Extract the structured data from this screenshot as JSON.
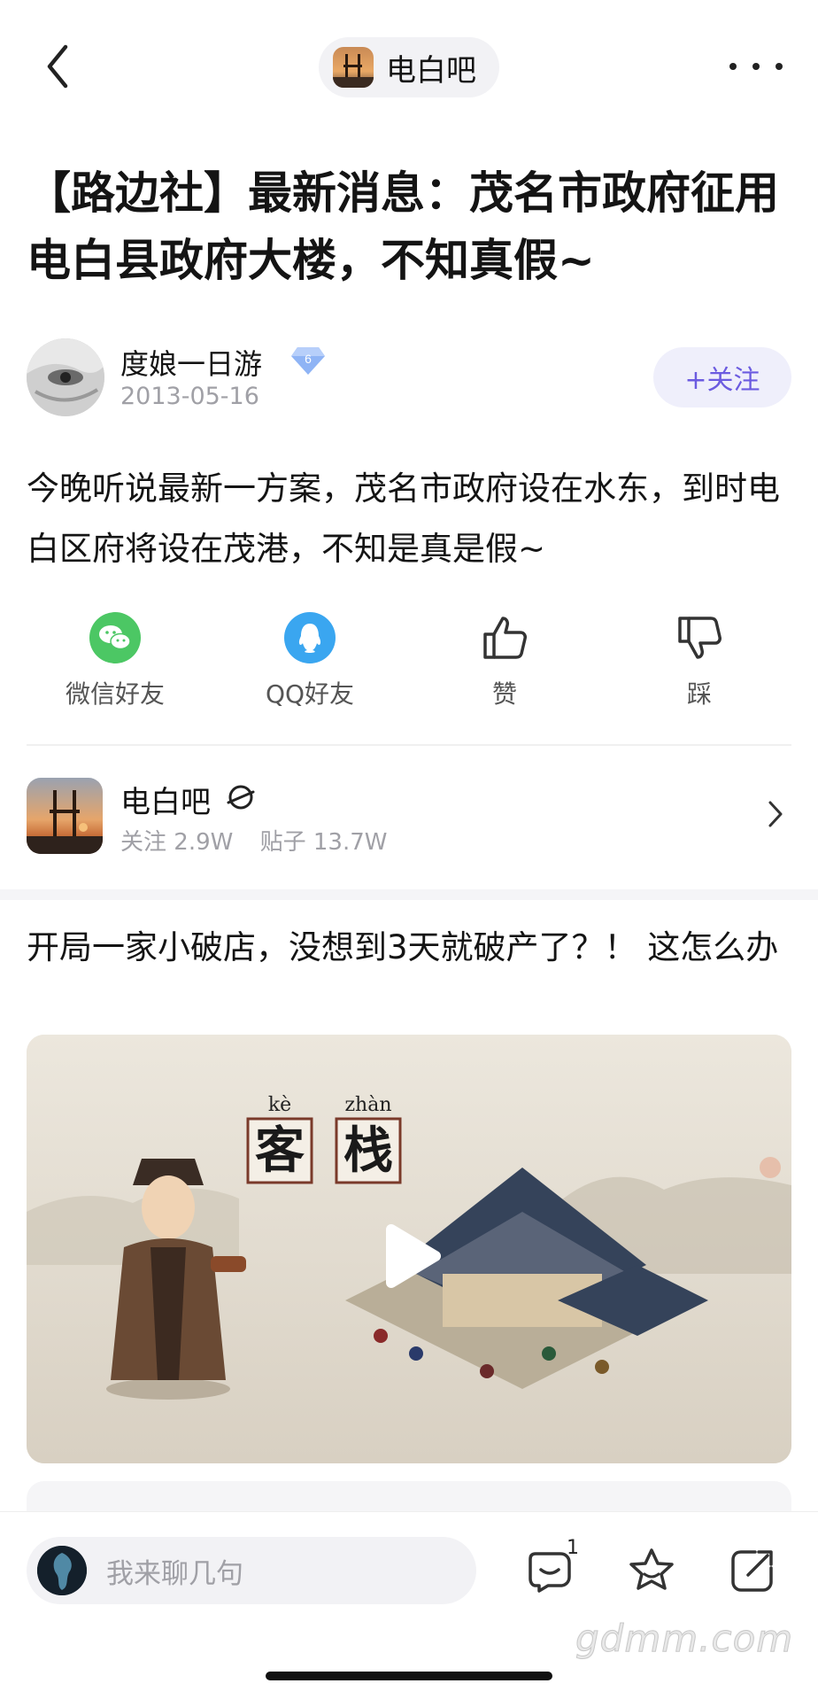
{
  "header": {
    "forum_name": "电白吧"
  },
  "post": {
    "title": "【路边社】最新消息：茂名市政府征用电白县政府大楼，不知真假~",
    "author": "度娘一日游",
    "level": "6",
    "date": "2013-05-16",
    "follow_label": "+关注",
    "body": "今晚听说最新一方案，茂名市政府设在水东，到时电白区府将设在茂港，不知是真是假~"
  },
  "share": {
    "items": [
      {
        "label": "微信好友",
        "icon": "wechat-icon"
      },
      {
        "label": "QQ好友",
        "icon": "qq-icon"
      },
      {
        "label": "赞",
        "icon": "thumbs-up-icon"
      },
      {
        "label": "踩",
        "icon": "thumbs-down-icon"
      }
    ]
  },
  "forum_card": {
    "name": "电白吧",
    "follow_label": "关注",
    "follow_count": "2.9W",
    "post_label": "贴子",
    "post_count": "13.7W"
  },
  "recommended": {
    "title": "开局一家小破店，没想到3天就破产了？！ 这怎么办",
    "video_text_1": "kè",
    "video_text_2": "zhàn",
    "video_char_1": "客",
    "video_char_2": "栈"
  },
  "bottom_bar": {
    "placeholder": "我来聊几句",
    "comment_count": "1",
    "watermark": "gdmm.com"
  },
  "colors": {
    "accent": "#6b5be0",
    "wechat": "#4cc764",
    "qq": "#3aa6f0"
  }
}
